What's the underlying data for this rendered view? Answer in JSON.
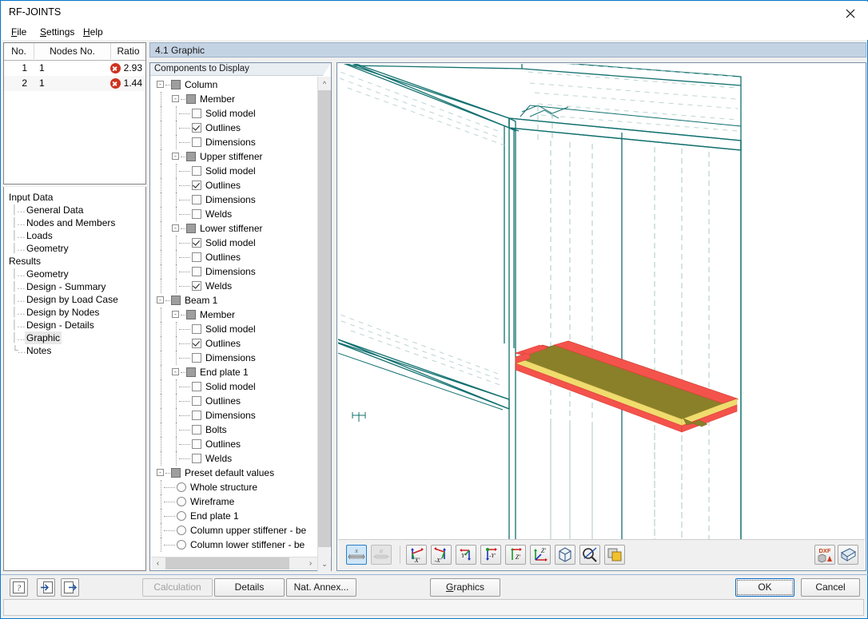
{
  "window": {
    "title": "RF-JOINTS",
    "close_icon": "close-icon"
  },
  "menubar": [
    {
      "label": "File",
      "accel": "F"
    },
    {
      "label": "Settings",
      "accel": "S"
    },
    {
      "label": "Help",
      "accel": "H"
    }
  ],
  "results_table": {
    "columns": [
      "No.",
      "Nodes No.",
      "Ratio"
    ],
    "sort_indicator": "⌃",
    "rows": [
      {
        "no": "1",
        "nodes_no": "1",
        "ratio": "2.93",
        "status": "error"
      },
      {
        "no": "2",
        "nodes_no": "1",
        "ratio": "1.44",
        "status": "error"
      }
    ]
  },
  "nav": [
    {
      "type": "group",
      "label": "Input Data"
    },
    {
      "type": "leaf",
      "label": "General Data",
      "selected": false
    },
    {
      "type": "leaf",
      "label": "Nodes and Members",
      "selected": false
    },
    {
      "type": "leaf",
      "label": "Loads",
      "selected": false
    },
    {
      "type": "leaf",
      "label": "Geometry",
      "selected": false
    },
    {
      "type": "group",
      "label": "Results"
    },
    {
      "type": "leaf",
      "label": "Geometry",
      "selected": false
    },
    {
      "type": "leaf",
      "label": "Design - Summary",
      "selected": false
    },
    {
      "type": "leaf",
      "label": "Design by Load Case",
      "selected": false
    },
    {
      "type": "leaf",
      "label": "Design by Nodes",
      "selected": false
    },
    {
      "type": "leaf",
      "label": "Design - Details",
      "selected": false
    },
    {
      "type": "leaf",
      "label": "Graphic",
      "selected": true
    },
    {
      "type": "leaf",
      "label": "Notes",
      "selected": false
    }
  ],
  "left_tools": [
    {
      "name": "help-button",
      "icon": "question-mark-icon"
    },
    {
      "name": "import-button",
      "icon": "import-arrow-icon"
    },
    {
      "name": "export-button",
      "icon": "export-arrow-icon"
    }
  ],
  "main": {
    "header_title": "4.1 Graphic",
    "tree_caption": "Components to Display"
  },
  "tree": [
    {
      "depth": 0,
      "ctrl": "checkbox",
      "state": "grey",
      "label": "Column",
      "expander": "-"
    },
    {
      "depth": 1,
      "ctrl": "checkbox",
      "state": "grey",
      "label": "Member",
      "expander": "-"
    },
    {
      "depth": 2,
      "ctrl": "checkbox",
      "state": "off",
      "label": "Solid model"
    },
    {
      "depth": 2,
      "ctrl": "checkbox",
      "state": "on",
      "label": "Outlines"
    },
    {
      "depth": 2,
      "ctrl": "checkbox",
      "state": "off",
      "label": "Dimensions"
    },
    {
      "depth": 1,
      "ctrl": "checkbox",
      "state": "grey",
      "label": "Upper stiffener",
      "expander": "-"
    },
    {
      "depth": 2,
      "ctrl": "checkbox",
      "state": "off",
      "label": "Solid model"
    },
    {
      "depth": 2,
      "ctrl": "checkbox",
      "state": "on",
      "label": "Outlines"
    },
    {
      "depth": 2,
      "ctrl": "checkbox",
      "state": "off",
      "label": "Dimensions"
    },
    {
      "depth": 2,
      "ctrl": "checkbox",
      "state": "off",
      "label": "Welds"
    },
    {
      "depth": 1,
      "ctrl": "checkbox",
      "state": "grey",
      "label": "Lower stiffener",
      "expander": "-"
    },
    {
      "depth": 2,
      "ctrl": "checkbox",
      "state": "on",
      "label": "Solid model"
    },
    {
      "depth": 2,
      "ctrl": "checkbox",
      "state": "off",
      "label": "Outlines"
    },
    {
      "depth": 2,
      "ctrl": "checkbox",
      "state": "off",
      "label": "Dimensions"
    },
    {
      "depth": 2,
      "ctrl": "checkbox",
      "state": "on",
      "label": "Welds"
    },
    {
      "depth": 0,
      "ctrl": "checkbox",
      "state": "grey",
      "label": "Beam 1",
      "expander": "-"
    },
    {
      "depth": 1,
      "ctrl": "checkbox",
      "state": "grey",
      "label": "Member",
      "expander": "-"
    },
    {
      "depth": 2,
      "ctrl": "checkbox",
      "state": "off",
      "label": "Solid model"
    },
    {
      "depth": 2,
      "ctrl": "checkbox",
      "state": "on",
      "label": "Outlines"
    },
    {
      "depth": 2,
      "ctrl": "checkbox",
      "state": "off",
      "label": "Dimensions"
    },
    {
      "depth": 1,
      "ctrl": "checkbox",
      "state": "grey",
      "label": "End plate 1",
      "expander": "-"
    },
    {
      "depth": 2,
      "ctrl": "checkbox",
      "state": "off",
      "label": "Solid model"
    },
    {
      "depth": 2,
      "ctrl": "checkbox",
      "state": "off",
      "label": "Outlines"
    },
    {
      "depth": 2,
      "ctrl": "checkbox",
      "state": "off",
      "label": "Dimensions"
    },
    {
      "depth": 2,
      "ctrl": "checkbox",
      "state": "off",
      "label": "Bolts"
    },
    {
      "depth": 2,
      "ctrl": "checkbox",
      "state": "off",
      "label": "Outlines"
    },
    {
      "depth": 2,
      "ctrl": "checkbox",
      "state": "off",
      "label": "Welds"
    },
    {
      "depth": 0,
      "ctrl": "checkbox",
      "state": "grey",
      "label": "Preset default values",
      "expander": "-"
    },
    {
      "depth": 1,
      "ctrl": "radio",
      "state": "off",
      "label": "Whole structure"
    },
    {
      "depth": 1,
      "ctrl": "radio",
      "state": "off",
      "label": "Wireframe"
    },
    {
      "depth": 1,
      "ctrl": "radio",
      "state": "off",
      "label": "End plate 1"
    },
    {
      "depth": 1,
      "ctrl": "radio",
      "state": "off",
      "label": "Column upper stiffener - be"
    },
    {
      "depth": 1,
      "ctrl": "radio",
      "state": "off",
      "label": "Column lower stiffener - be"
    }
  ],
  "gfx_toolbar": {
    "left": [
      {
        "name": "dimension-x-button",
        "icon": "dimension-x-icon",
        "label": "x",
        "state": "active"
      },
      {
        "name": "dimension-a-button",
        "icon": "dimension-a-icon",
        "label": "a",
        "state": "disabled"
      }
    ],
    "views": [
      {
        "name": "view-x-button",
        "icon": "axis-x-icon",
        "label": "X'"
      },
      {
        "name": "view-neg-x-button",
        "icon": "axis-negx-icon",
        "label": "-X'"
      },
      {
        "name": "view-y-button",
        "icon": "axis-y-icon",
        "label": "Y'"
      },
      {
        "name": "view-neg-y-button",
        "icon": "axis-negy-icon",
        "label": "-Y'"
      },
      {
        "name": "view-z-button",
        "icon": "axis-z-icon",
        "label": "Z'"
      },
      {
        "name": "view-isometric-axes-button",
        "icon": "axis-triad-icon",
        "label": "Z'"
      },
      {
        "name": "view-isometric-button",
        "icon": "cube-icon",
        "label": ""
      },
      {
        "name": "zoom-reset-button",
        "icon": "magnifier-reset-icon",
        "label": ""
      },
      {
        "name": "layers-button",
        "icon": "layers-icon",
        "label": ""
      }
    ],
    "right": [
      {
        "name": "dxf-export-button",
        "icon": "dxf-icon",
        "label": "DXF"
      },
      {
        "name": "print-button",
        "icon": "printer-icon",
        "label": ""
      }
    ]
  },
  "actions": {
    "calculation": {
      "label": "Calculation",
      "enabled": false
    },
    "details": {
      "label": "Details",
      "enabled": true
    },
    "nat_annex": {
      "label": "Nat. Annex...",
      "enabled": true
    },
    "graphics": {
      "label": "Graphics",
      "enabled": true,
      "accel": "G"
    },
    "ok": {
      "label": "OK",
      "enabled": true,
      "focused": true
    },
    "cancel": {
      "label": "Cancel",
      "enabled": true
    }
  },
  "statusbar": {
    "text": ""
  },
  "colors": {
    "accent": "#0a7ad1",
    "header_bg": "#c4d3e3",
    "outline_teal": "#11706f",
    "hidden_line": "#9fc0bf",
    "plate_olive": "#8a8029",
    "weld_red": "#f4534c",
    "plate_yellow": "#f0dc6e",
    "error_red": "#cf3321"
  }
}
